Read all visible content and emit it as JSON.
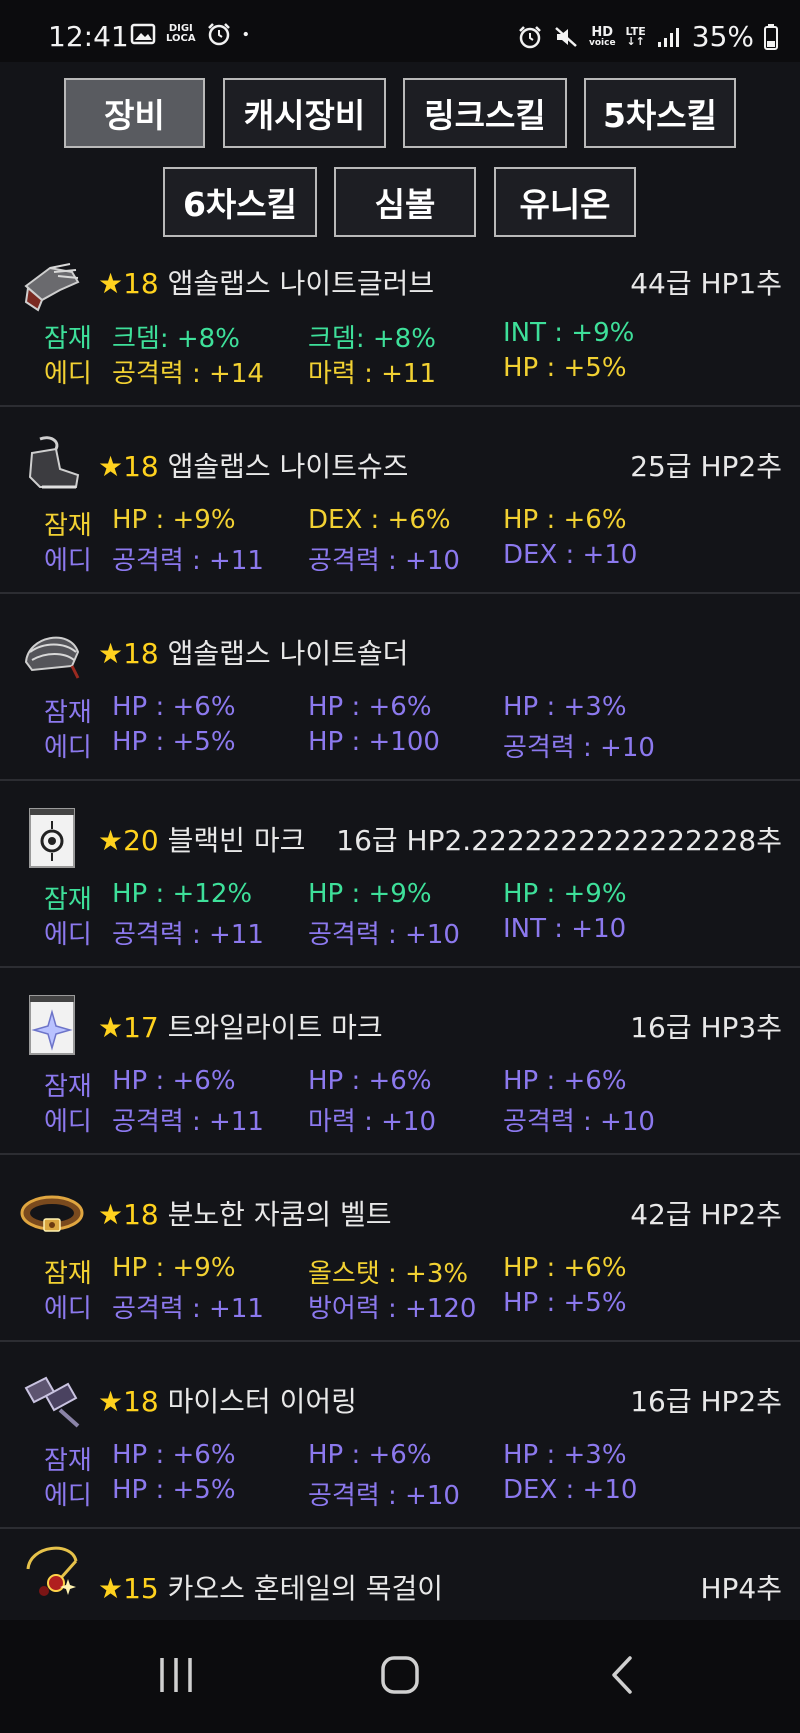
{
  "status_bar": {
    "time": "12:41",
    "left_icons": [
      "image-icon",
      "digi-loca-icon",
      "alarm-icon",
      "dot-icon"
    ],
    "digi_text_top": "DIGI",
    "digi_text_bottom": "LOCA",
    "right_icons": [
      "alarm-icon",
      "mute-icon",
      "hd-voice-icon",
      "lte-icon",
      "signal-icon"
    ],
    "hd_text_top": "HD",
    "hd_text_bottom": "voice",
    "lte_text": "LTE",
    "battery_percent": "35%"
  },
  "tabs": [
    {
      "label": "장비",
      "active": true
    },
    {
      "label": "캐시장비",
      "active": false
    },
    {
      "label": "링크스킬",
      "active": false
    },
    {
      "label": "5차스킬",
      "active": false
    },
    {
      "label": "6차스킬",
      "active": false
    },
    {
      "label": "심볼",
      "active": false
    },
    {
      "label": "유니온",
      "active": false
    }
  ],
  "items": [
    {
      "icon": "glove-icon",
      "star": "★18",
      "name": "앱솔랩스 나이트글러브",
      "grade": "44급 HP1추",
      "rows": [
        {
          "label": "잠재",
          "label_color": "green",
          "color": "green",
          "values": [
            "크뎀: +8%",
            "크뎀: +8%",
            "INT : +9%"
          ]
        },
        {
          "label": "에디",
          "label_color": "yellow",
          "color": "yellow",
          "values": [
            "공격력 : +14",
            "마력 : +11",
            "HP : +5%"
          ]
        }
      ]
    },
    {
      "icon": "shoes-icon",
      "star": "★18",
      "name": "앱솔랩스 나이트슈즈",
      "grade": "25급 HP2추",
      "rows": [
        {
          "label": "잠재",
          "label_color": "yellow",
          "color": "yellow",
          "values": [
            "HP : +9%",
            "DEX : +6%",
            "HP : +6%"
          ]
        },
        {
          "label": "에디",
          "label_color": "purple",
          "color": "purple",
          "values": [
            "공격력 : +11",
            "공격력 : +10",
            "DEX : +10"
          ]
        }
      ]
    },
    {
      "icon": "shoulder-icon",
      "star": "★18",
      "name": "앱솔랩스 나이트숄더",
      "grade": "",
      "rows": [
        {
          "label": "잠재",
          "label_color": "purple",
          "color": "purple",
          "values": [
            "HP : +6%",
            "HP : +6%",
            "HP : +3%"
          ]
        },
        {
          "label": "에디",
          "label_color": "purple",
          "color": "purple",
          "values": [
            "HP : +5%",
            "HP : +100",
            "공격력 : +10"
          ]
        }
      ]
    },
    {
      "icon": "emblem-icon",
      "star": "★20",
      "name": "블랙빈 마크",
      "grade": "16급 HP2.2222222222222228추",
      "rows": [
        {
          "label": "잠재",
          "label_color": "green",
          "color": "green",
          "values": [
            "HP : +12%",
            "HP : +9%",
            "HP : +9%"
          ]
        },
        {
          "label": "에디",
          "label_color": "purple",
          "color": "purple",
          "values": [
            "공격력 : +11",
            "공격력 : +10",
            "INT : +10"
          ]
        }
      ]
    },
    {
      "icon": "twilight-mark-icon",
      "star": "★17",
      "name": "트와일라이트 마크",
      "grade": "16급 HP3추",
      "rows": [
        {
          "label": "잠재",
          "label_color": "purple",
          "color": "purple",
          "values": [
            "HP : +6%",
            "HP : +6%",
            "HP : +6%"
          ]
        },
        {
          "label": "에디",
          "label_color": "purple",
          "color": "purple",
          "values": [
            "공격력 : +11",
            "마력 : +10",
            "공격력 : +10"
          ]
        }
      ]
    },
    {
      "icon": "belt-icon",
      "star": "★18",
      "name": "분노한 자쿰의 벨트",
      "grade": "42급 HP2추",
      "rows": [
        {
          "label": "잠재",
          "label_color": "yellow",
          "color": "yellow",
          "values": [
            "HP : +9%",
            "올스탯 : +3%",
            "HP : +6%"
          ]
        },
        {
          "label": "에디",
          "label_color": "purple",
          "color": "purple",
          "values": [
            "공격력 : +11",
            "방어력 : +120",
            "HP : +5%"
          ]
        }
      ]
    },
    {
      "icon": "earring-icon",
      "star": "★18",
      "name": "마이스터 이어링",
      "grade": "16급 HP2추",
      "rows": [
        {
          "label": "잠재",
          "label_color": "purple",
          "color": "purple",
          "values": [
            "HP : +6%",
            "HP : +6%",
            "HP : +3%"
          ]
        },
        {
          "label": "에디",
          "label_color": "purple",
          "color": "purple",
          "values": [
            "HP : +5%",
            "공격력 : +10",
            "DEX : +10"
          ]
        }
      ]
    },
    {
      "icon": "necklace-icon",
      "star": "★15",
      "name": "카오스 혼테일의 목걸이",
      "grade": "HP4추",
      "rows": []
    }
  ],
  "nav_bar": {
    "buttons": [
      "recent-apps-icon",
      "home-icon",
      "back-icon"
    ]
  },
  "colors": {
    "background": "#131418",
    "star": "#ffd21e",
    "green": "#3ee09a",
    "yellow": "#f2d132",
    "purple": "#8c79ee",
    "tab_active": "#595b60",
    "tab_inactive": "#1d1e23"
  }
}
